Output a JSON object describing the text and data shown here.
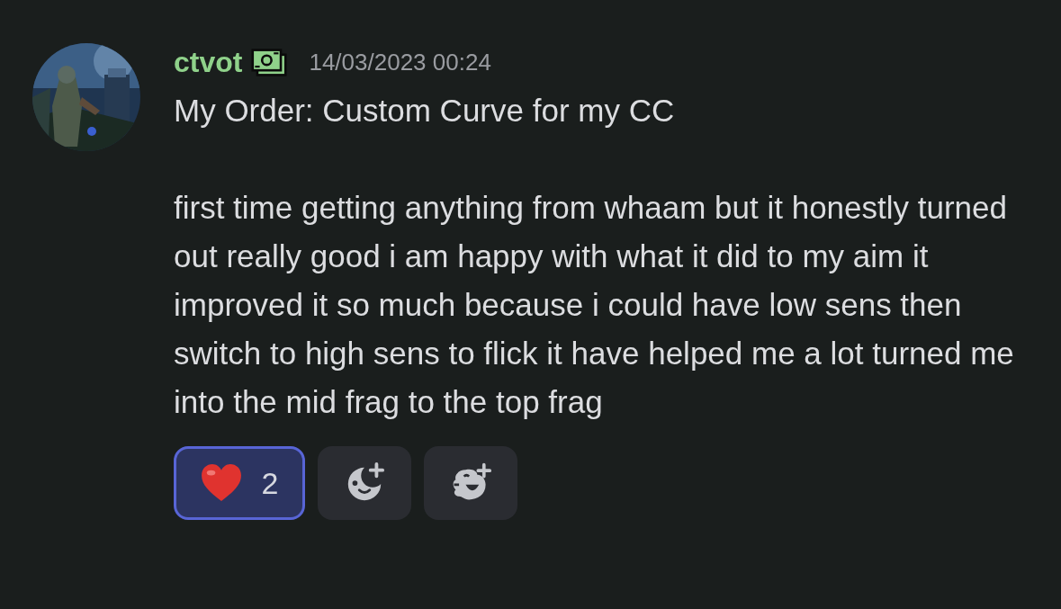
{
  "message": {
    "author": "ctvot",
    "timestamp": "14/03/2023 00:24",
    "lines": [
      "My Order: Custom Curve for my CC",
      "first time getting anything from whaam but it honestly turned out really good i am happy with what it did to my aim it improved it so much because i could have low sens then switch to high sens to flick it have helped me a lot turned me into the mid frag to the top frag"
    ],
    "reactions": [
      {
        "kind": "heart",
        "count": "2",
        "selected": true
      },
      {
        "kind": "add-emoji"
      },
      {
        "kind": "add-sticker"
      }
    ]
  }
}
